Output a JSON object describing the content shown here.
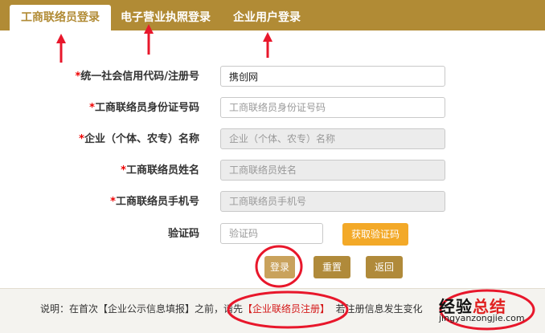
{
  "tabs": [
    {
      "label": "工商联络员登录",
      "active": true
    },
    {
      "label": "电子营业执照登录",
      "active": false
    },
    {
      "label": "企业用户登录",
      "active": false
    }
  ],
  "form": {
    "required_mark": "*",
    "credit_code": {
      "label": "统一社会信用代码/注册号",
      "value": "携创网"
    },
    "id_number": {
      "label": "工商联络员身份证号码",
      "placeholder": "工商联络员身份证号码"
    },
    "company_name": {
      "label": "企业（个体、农专）名称",
      "placeholder": "企业（个体、农专）名称"
    },
    "liaison_name": {
      "label": "工商联络员姓名",
      "placeholder": "工商联络员姓名"
    },
    "liaison_phone": {
      "label": "工商联络员手机号",
      "placeholder": "工商联络员手机号"
    },
    "captcha": {
      "label": "验证码",
      "placeholder": "验证码"
    },
    "get_code_label": "获取验证码"
  },
  "buttons": {
    "login": "登录",
    "reset": "重置",
    "back": "返回"
  },
  "footer": {
    "prefix": "说明：在首次【企业公示信息填报】之前，请先",
    "link": "【企业联络员注册】",
    "suffix": "若注册信息发生变化"
  },
  "watermark": {
    "main_a": "经验",
    "main_b": "总结",
    "sub": "jingyanzongjie.com"
  },
  "colors": {
    "brand": "#b18b35",
    "required": "#ee0000",
    "annotation": "#e8172b",
    "code_button": "#f3a928"
  }
}
